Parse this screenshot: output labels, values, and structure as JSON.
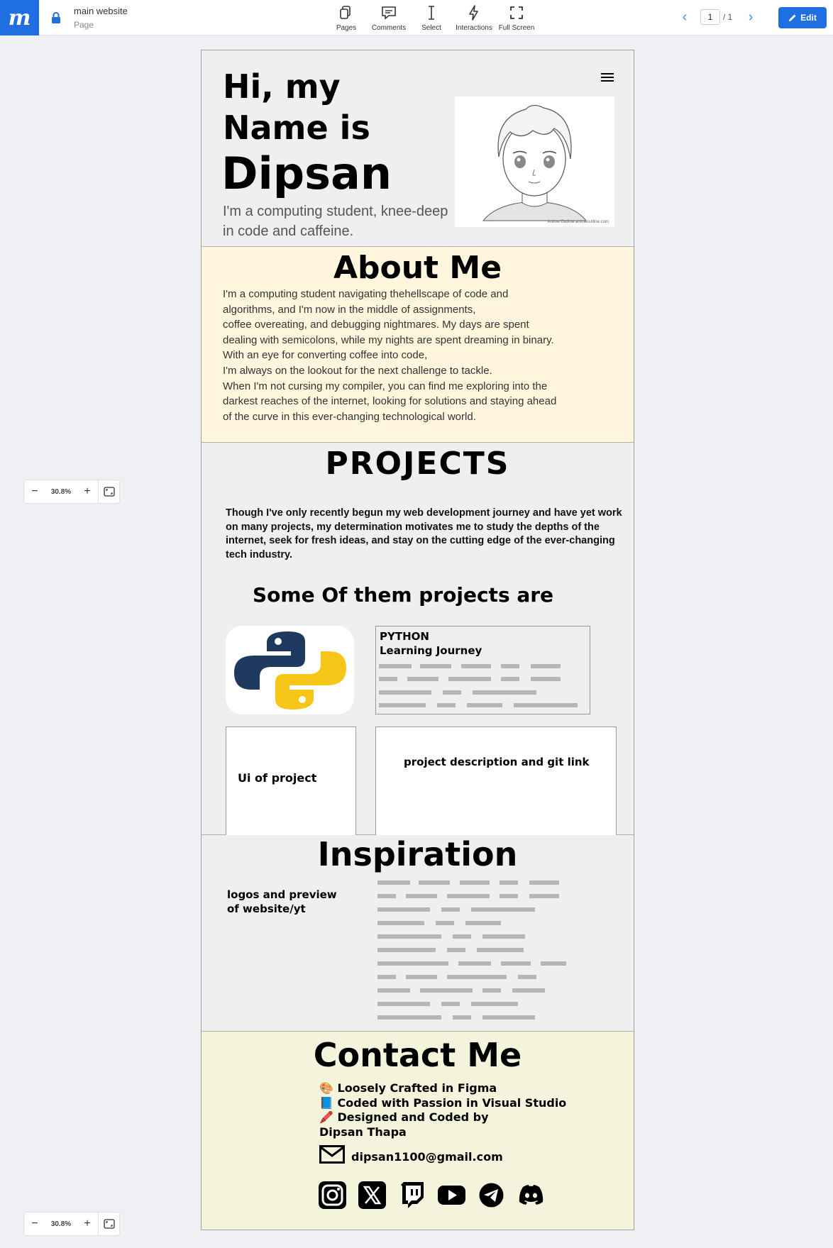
{
  "toolbar": {
    "project_title": "main website",
    "project_subtitle": "Page",
    "tools": [
      {
        "label": "Pages",
        "icon": "pages-icon"
      },
      {
        "label": "Comments",
        "icon": "comment-icon"
      },
      {
        "label": "Select",
        "icon": "text-cursor-icon"
      },
      {
        "label": "Interactions",
        "icon": "lightning-icon"
      },
      {
        "label": "Full Screen",
        "icon": "fullscreen-icon"
      }
    ],
    "page_current": "1",
    "page_total": "/ 1",
    "edit_label": "Edit"
  },
  "zoom": {
    "level": "30.8%"
  },
  "colors": {
    "accent": "#1f6fe0",
    "about_bg": "#fff6dd",
    "contact_bg": "#f4f3db",
    "section_bg": "#efefef"
  },
  "hero": {
    "line1": "Hi, my",
    "line2": "Name is",
    "name": "Dipsan",
    "tagline": "I'm a computing student, knee-deep in code and caffeine.",
    "avatar_credit": "Anime Outline animeoutline.com"
  },
  "about": {
    "heading": "About Me",
    "text": "I'm a computing student navigating thehellscape of code and\nalgorithms, and I'm now in the middle of assignments,\ncoffee overeating, and debugging nightmares. My days are spent\ndealing with semicolons, while my nights are spent dreaming in binary.\n With an eye for converting coffee into code,\nI'm always on the lookout for the next challenge to tackle.\nWhen I'm not cursing my compiler, you can find me exploring into the\ndarkest reaches of the internet, looking for solutions and staying ahead\n of the curve in this ever-changing technological world."
  },
  "projects": {
    "heading": "PROJECTS",
    "intro": "Though I've only recently begun my web development journey and have yet work on many projects, my determination motivates me to study the depths of the internet, seek for fresh ideas, and stay on the cutting edge of the ever-changing tech industry.",
    "subheading": "Some Of them projects are",
    "card_title": "PYTHON",
    "card_subtitle": "Learning Journey",
    "ui_label": "Ui of project",
    "desc_label": "project description and git link"
  },
  "inspiration": {
    "heading": "Inspiration",
    "text": "logos and preview\n of website/yt"
  },
  "contact": {
    "heading": "Contact Me",
    "credits": [
      "🎨 Loosely Crafted in Figma",
      "📘 Coded with Passion in Visual Studio",
      "🖍️ Designed and Coded by",
      "Dipsan Thapa"
    ],
    "email": "dipsan1100@gmail.com",
    "socials": [
      "instagram-icon",
      "x-icon",
      "twitch-icon",
      "youtube-icon",
      "telegram-icon",
      "discord-icon"
    ]
  }
}
